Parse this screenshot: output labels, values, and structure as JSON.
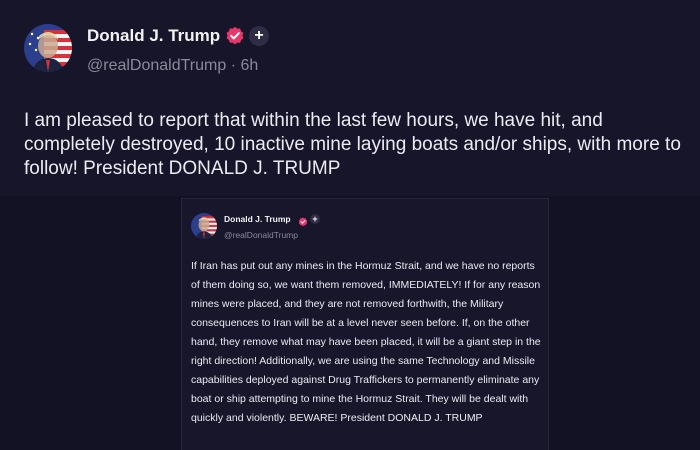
{
  "colors": {
    "background": "#131225",
    "card": "#16152a",
    "text": "#ecebf2",
    "muted": "#8a8a9c",
    "verified_badge": "#e8386b",
    "plus_badge": "#2e2d45"
  },
  "main_post": {
    "display_name": "Donald J. Trump",
    "handle_time": "@realDonaldTrump · 6h",
    "verified_icon": "verified-badge-icon",
    "follow_icon": "plus-icon",
    "follow_label": "+",
    "body": "I am pleased to report that within the last few hours, we have hit, and completely destroyed, 10 inactive mine laying boats and/or ships, with more to follow! President DONALD J. TRUMP"
  },
  "embedded_post": {
    "display_name": "Donald J. Trump",
    "handle": "@realDonaldTrump",
    "verified_icon": "verified-badge-icon",
    "follow_icon": "plus-icon",
    "follow_label": "+",
    "body": "If Iran has put out any mines in the Hormuz Strait, and we have no reports of them doing so, we want them removed, IMMEDIATELY! If for any reason mines were placed, and they are not removed forthwith, the Military consequences to Iran will be at a level never seen before. If, on the other hand, they remove what may have been placed, it will be a giant step in the right direction! Additionally, we are using the same Technology and Missile capabilities deployed against Drug Traffickers to permanently eliminate any boat or ship attempting to mine the Hormuz Strait. They will be dealt with quickly and violently. BEWARE! President DONALD J. TRUMP"
  }
}
